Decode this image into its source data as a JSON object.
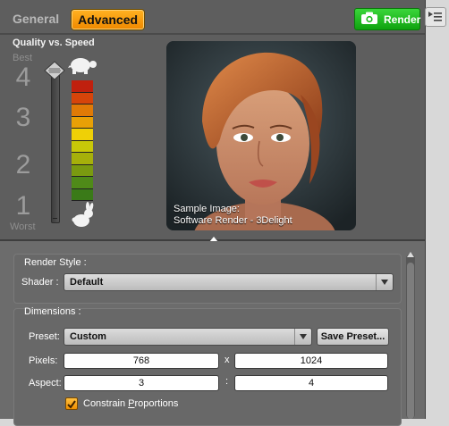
{
  "tabs": [
    {
      "label": "General",
      "active": false
    },
    {
      "label": "Advanced",
      "active": true
    }
  ],
  "render_button": {
    "label": "Render",
    "icon": "camera-icon",
    "color": "#1ab81a"
  },
  "quality": {
    "title": "Quality vs. Speed",
    "best_label": "Best",
    "worst_label": "Worst",
    "levels": [
      "4",
      "3",
      "2",
      "1"
    ],
    "slider_level": 4,
    "meter_colors": [
      "#c0200e",
      "#d6440a",
      "#e07a06",
      "#e8a006",
      "#efd006",
      "#c8c808",
      "#a6b00a",
      "#7a9a10",
      "#4f8a18",
      "#3a7a18"
    ]
  },
  "preview": {
    "caption_line1": "Sample Image:",
    "caption_line2": "Software Render - 3Delight"
  },
  "render_style": {
    "group_label": "Render Style :",
    "shader_label": "Shader :",
    "shader_value": "Default"
  },
  "dimensions": {
    "group_label": "Dimensions :",
    "preset_label": "Preset:",
    "preset_value": "Custom",
    "save_preset_label": "Save Preset...",
    "pixels_label": "Pixels:",
    "pixels_width": "768",
    "pixels_sep": "x",
    "pixels_height": "1024",
    "aspect_label": "Aspect:",
    "aspect_width": "3",
    "aspect_sep": ":",
    "aspect_height": "4",
    "constrain_label_pre": "Constrain ",
    "constrain_label_u": "P",
    "constrain_label_post": "roportions",
    "constrain_checked": true
  },
  "colors": {
    "accent": "#f59a10",
    "panel": "#5e5e5e",
    "render_green": "#1ab81a"
  }
}
